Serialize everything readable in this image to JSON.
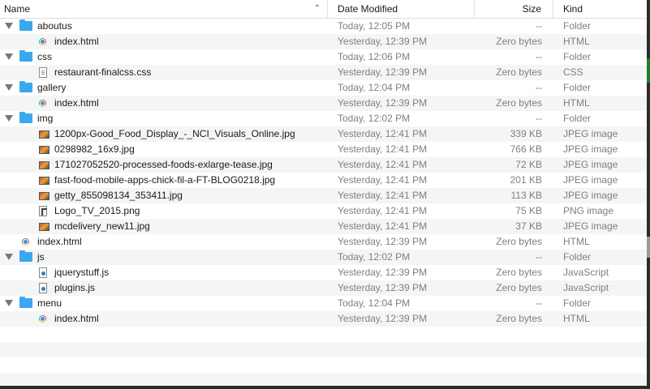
{
  "columns": {
    "name": "Name",
    "date": "Date Modified",
    "size": "Size",
    "kind": "Kind"
  },
  "rows": [
    {
      "name": "aboutus",
      "date": "Today, 12:05 PM",
      "size": "--",
      "kind": "Folder",
      "icon": "folder-icon",
      "level": 0,
      "expanded": true
    },
    {
      "name": "index.html",
      "date": "Yesterday, 12:39 PM",
      "size": "Zero bytes",
      "kind": "HTML",
      "icon": "chrome-icon",
      "level": 1
    },
    {
      "name": "css",
      "date": "Today, 12:06 PM",
      "size": "--",
      "kind": "Folder",
      "icon": "folder-icon",
      "level": 0,
      "expanded": true
    },
    {
      "name": "restaurant-finalcss.css",
      "date": "Yesterday, 12:39 PM",
      "size": "Zero bytes",
      "kind": "CSS",
      "icon": "css-file-icon",
      "level": 1
    },
    {
      "name": "gallery",
      "date": "Today, 12:04 PM",
      "size": "--",
      "kind": "Folder",
      "icon": "folder-icon",
      "level": 0,
      "expanded": true
    },
    {
      "name": "index.html",
      "date": "Yesterday, 12:39 PM",
      "size": "Zero bytes",
      "kind": "HTML",
      "icon": "chrome-icon",
      "level": 1
    },
    {
      "name": "img",
      "date": "Today, 12:02 PM",
      "size": "--",
      "kind": "Folder",
      "icon": "folder-icon",
      "level": 0,
      "expanded": true
    },
    {
      "name": "1200px-Good_Food_Display_-_NCI_Visuals_Online.jpg",
      "date": "Yesterday, 12:41 PM",
      "size": "339 KB",
      "kind": "JPEG image",
      "icon": "jpeg-thumbnail-icon",
      "level": 1
    },
    {
      "name": "0298982_16x9.jpg",
      "date": "Yesterday, 12:41 PM",
      "size": "766 KB",
      "kind": "JPEG image",
      "icon": "jpeg-thumbnail-icon",
      "level": 1
    },
    {
      "name": "171027052520-processed-foods-exlarge-tease.jpg",
      "date": "Yesterday, 12:41 PM",
      "size": "72 KB",
      "kind": "JPEG image",
      "icon": "jpeg-thumbnail-icon",
      "level": 1
    },
    {
      "name": "fast-food-mobile-apps-chick-fil-a-FT-BLOG0218.jpg",
      "date": "Yesterday, 12:41 PM",
      "size": "201 KB",
      "kind": "JPEG image",
      "icon": "jpeg-thumbnail-icon",
      "level": 1
    },
    {
      "name": "getty_855098134_353411.jpg",
      "date": "Yesterday, 12:41 PM",
      "size": "113 KB",
      "kind": "JPEG image",
      "icon": "jpeg-thumbnail-icon",
      "level": 1
    },
    {
      "name": "Logo_TV_2015.png",
      "date": "Yesterday, 12:41 PM",
      "size": "75 KB",
      "kind": "PNG image",
      "icon": "png-thumbnail-icon",
      "level": 1
    },
    {
      "name": "mcdelivery_new11.jpg",
      "date": "Yesterday, 12:41 PM",
      "size": "37 KB",
      "kind": "JPEG image",
      "icon": "jpeg-thumbnail-icon",
      "level": 1
    },
    {
      "name": "index.html",
      "date": "Yesterday, 12:39 PM",
      "size": "Zero bytes",
      "kind": "HTML",
      "icon": "chrome-icon",
      "level": 0,
      "file": true
    },
    {
      "name": "js",
      "date": "Today, 12:02 PM",
      "size": "--",
      "kind": "Folder",
      "icon": "folder-icon",
      "level": 0,
      "expanded": true
    },
    {
      "name": "jquerystuff.js",
      "date": "Yesterday, 12:39 PM",
      "size": "Zero bytes",
      "kind": "JavaScript",
      "icon": "js-file-icon",
      "level": 1
    },
    {
      "name": "plugins.js",
      "date": "Yesterday, 12:39 PM",
      "size": "Zero bytes",
      "kind": "JavaScript",
      "icon": "js-file-icon",
      "level": 1
    },
    {
      "name": "menu",
      "date": "Today, 12:04 PM",
      "size": "--",
      "kind": "Folder",
      "icon": "folder-icon",
      "level": 0,
      "expanded": true
    },
    {
      "name": "index.html",
      "date": "Yesterday, 12:39 PM",
      "size": "Zero bytes",
      "kind": "HTML",
      "icon": "chrome-icon",
      "level": 1
    }
  ],
  "empty_rows": 4
}
